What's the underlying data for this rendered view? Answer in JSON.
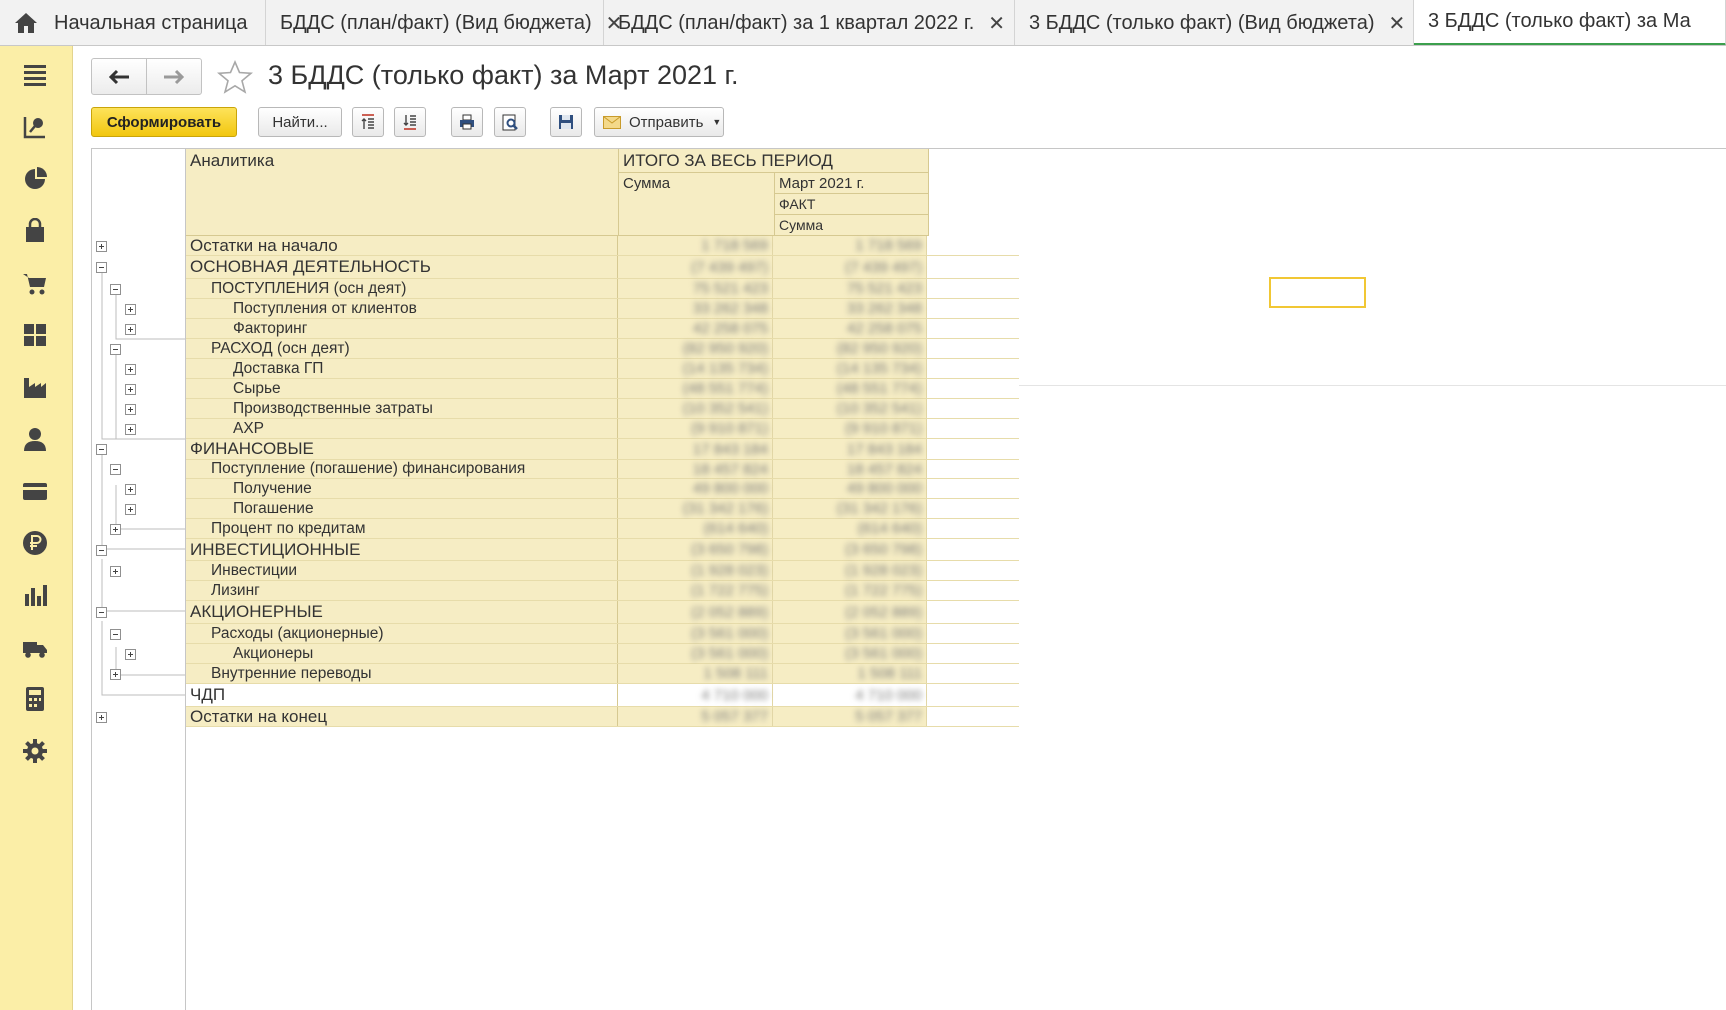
{
  "tabs": {
    "home": "Начальная страница",
    "items": [
      {
        "label": "БДДС (план/факт) (Вид бюджета)",
        "close": "✕"
      },
      {
        "label": "БДДС (план/факт)  за 1 квартал 2022 г.",
        "close": "✕"
      },
      {
        "label": "3 БДДС (только факт) (Вид бюджета)",
        "close": "✕"
      },
      {
        "label": "3 БДДС (только факт)  за Ма",
        "close": ""
      }
    ]
  },
  "sidebar_icons": [
    "menu-icon",
    "sales-funnel-icon",
    "pie-chart-icon",
    "shopping-bag-icon",
    "cart-icon",
    "grid-icon",
    "factory-icon",
    "person-icon",
    "card-icon",
    "ruble-icon",
    "bar-chart-icon",
    "truck-icon",
    "calculator-icon",
    "gear-icon"
  ],
  "window": {
    "title": "3 БДДС (только факт)  за Март 2021 г."
  },
  "toolbar": {
    "generate": "Сформировать",
    "find": "Найти...",
    "send": "Отправить"
  },
  "report": {
    "header": {
      "analytics": "Аналитика",
      "total": "ИТОГО ЗА ВЕСЬ ПЕРИОД",
      "sum": "Сумма",
      "period": "Март 2021 г.",
      "fact": "ФАКТ",
      "sum2": "Сумма"
    },
    "rows": [
      {
        "label": "Остатки на начало",
        "level": 0,
        "v1": "1 718 569",
        "v2": "1 718 569",
        "toggle": "plus"
      },
      {
        "label": "ОСНОВНАЯ ДЕЯТЕЛЬНОСТЬ",
        "level": 0,
        "v1": "(7 439 497)",
        "v2": "(7 439 497)",
        "toggle": "minus"
      },
      {
        "label": "ПОСТУПЛЕНИЯ (осн деят)",
        "level": 1,
        "v1": "75 521 423",
        "v2": "75 521 423",
        "toggle": "minus"
      },
      {
        "label": "Поступления от клиентов",
        "level": 2,
        "v1": "33 262 348",
        "v2": "33 262 348",
        "toggle": "plus"
      },
      {
        "label": "Факторинг",
        "level": 2,
        "v1": "42 258 075",
        "v2": "42 258 075",
        "toggle": "plus"
      },
      {
        "label": "РАСХОД (осн деят)",
        "level": 1,
        "v1": "(82 950 920)",
        "v2": "(82 950 920)",
        "toggle": "minus"
      },
      {
        "label": "Доставка ГП",
        "level": 2,
        "v1": "(14 135 734)",
        "v2": "(14 135 734)",
        "toggle": "plus"
      },
      {
        "label": "Сырье",
        "level": 2,
        "v1": "(48 551 774)",
        "v2": "(48 551 774)",
        "toggle": "plus"
      },
      {
        "label": "Производственные затраты",
        "level": 2,
        "v1": "(10 352 541)",
        "v2": "(10 352 541)",
        "toggle": "plus"
      },
      {
        "label": "АХР",
        "level": 2,
        "v1": "(9 910 871)",
        "v2": "(9 910 871)",
        "toggle": "plus"
      },
      {
        "label": "ФИНАНСОВЫЕ",
        "level": 0,
        "v1": "17 843 184",
        "v2": "17 843 184",
        "toggle": "minus"
      },
      {
        "label": "Поступление (погашение) финансирования",
        "level": 1,
        "v1": "18 457 824",
        "v2": "18 457 824",
        "toggle": "minus"
      },
      {
        "label": "Получение",
        "level": 2,
        "v1": "49 800 000",
        "v2": "49 800 000",
        "toggle": "plus"
      },
      {
        "label": "Погашение",
        "level": 2,
        "v1": "(31 342 176)",
        "v2": "(31 342 176)",
        "toggle": "plus"
      },
      {
        "label": "Процент по кредитам",
        "level": 1,
        "v1": "(614 640)",
        "v2": "(614 640)",
        "toggle": "plus"
      },
      {
        "label": "ИНВЕСТИЦИОННЫЕ",
        "level": 0,
        "v1": "(3 650 798)",
        "v2": "(3 650 798)",
        "toggle": "minus"
      },
      {
        "label": "Инвестиции",
        "level": 1,
        "v1": "(1 928 023)",
        "v2": "(1 928 023)",
        "toggle": "plus"
      },
      {
        "label": "Лизинг",
        "level": 1,
        "v1": "(1 722 775)",
        "v2": "(1 722 775)",
        "toggle": "none"
      },
      {
        "label": "АКЦИОНЕРНЫЕ",
        "level": 0,
        "v1": "(2 052 889)",
        "v2": "(2 052 889)",
        "toggle": "minus"
      },
      {
        "label": "Расходы (акционерные)",
        "level": 1,
        "v1": "(3 561 000)",
        "v2": "(3 561 000)",
        "toggle": "minus"
      },
      {
        "label": "Акционеры",
        "level": 2,
        "v1": "(3 561 000)",
        "v2": "(3 561 000)",
        "toggle": "plus"
      },
      {
        "label": "Внутренние переводы",
        "level": 1,
        "v1": "1 508 111",
        "v2": "1 508 111",
        "toggle": "plus"
      },
      {
        "label": "ЧДП",
        "level": 0,
        "v1": "4 710 000",
        "v2": "4 710 000",
        "toggle": "none",
        "plain": true
      },
      {
        "label": "Остатки на конец",
        "level": 0,
        "v1": "5 057 377",
        "v2": "5 057 377",
        "toggle": "plus"
      }
    ]
  }
}
